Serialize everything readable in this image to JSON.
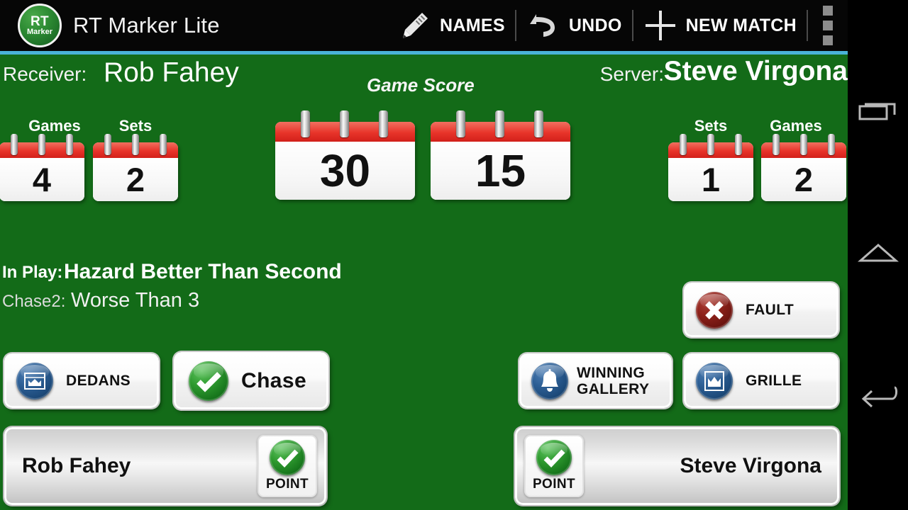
{
  "app": {
    "title": "RT Marker Lite",
    "logo": {
      "line1": "RT",
      "line2": "Marker"
    },
    "accent_color": "#4ab3d8",
    "background_color": "#136b18"
  },
  "toolbar": {
    "actions": [
      {
        "label": "NAMES",
        "icon": "pencil-icon"
      },
      {
        "label": "UNDO",
        "icon": "undo-icon"
      },
      {
        "label": "NEW MATCH",
        "icon": "plus-icon"
      }
    ],
    "overflow_icon": "overflow-menu-icon"
  },
  "match": {
    "receiver_label": "Receiver:",
    "receiver_name": "Rob Fahey",
    "server_label": "Server:",
    "server_name": "Steve Virgona",
    "game_score_title": "Game Score",
    "left": {
      "games_caption": "Games",
      "games_value": "4",
      "sets_caption": "Sets",
      "sets_value": "2",
      "score": "30"
    },
    "right": {
      "sets_caption": "Sets",
      "sets_value": "1",
      "games_caption": "Games",
      "games_value": "2",
      "score": "15"
    },
    "in_play_label": "In Play:",
    "in_play_value": "Hazard Better Than Second",
    "chase_label": "Chase2:",
    "chase_value": "Worse Than 3"
  },
  "buttons": {
    "fault": {
      "label": "FAULT",
      "icon": "cross-circle-icon",
      "color": "#8d211a"
    },
    "dedans": {
      "label": "DEDANS",
      "icon": "crown-banner-icon",
      "color": "#2d5f95"
    },
    "chase": {
      "label": "Chase",
      "icon": "check-circle-icon",
      "color": "#2f9b30"
    },
    "winning_gallery": {
      "label_line1": "WINNING",
      "label_line2": "GALLERY",
      "icon": "bell-icon",
      "color": "#2d5f95"
    },
    "grille": {
      "label": "GRILLE",
      "icon": "crown-square-icon",
      "color": "#2d5f95"
    }
  },
  "point_bars": {
    "left": {
      "name": "Rob Fahey",
      "point_label": "POINT",
      "icon": "check-circle-icon"
    },
    "right": {
      "name": "Steve Virgona",
      "point_label": "POINT",
      "icon": "check-circle-icon"
    }
  },
  "navbar": {
    "recent_label": "recent-apps",
    "home_label": "home",
    "back_label": "back"
  }
}
